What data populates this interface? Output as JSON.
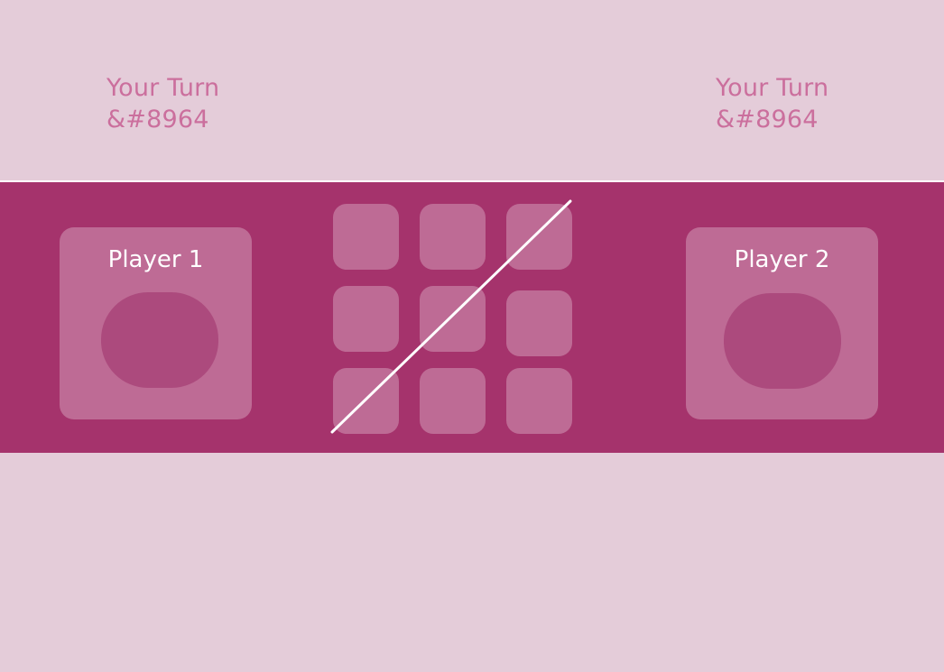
{
  "players": [
    {
      "name": "Player 1",
      "turn_label": "Your Turn",
      "turn_glyph": "&#8964"
    },
    {
      "name": "Player 2",
      "turn_label": "Your Turn",
      "turn_glyph": "&#8964"
    }
  ],
  "board": {
    "cells": [
      "",
      "",
      "",
      "",
      "",
      "",
      "",
      "",
      ""
    ],
    "winning_line": "diagonal-bottom-left-to-top-right"
  },
  "colors": {
    "background": "#e4ccd9",
    "band": "#a5336c",
    "turn_text": "#c4558d",
    "line": "#ffffff"
  }
}
